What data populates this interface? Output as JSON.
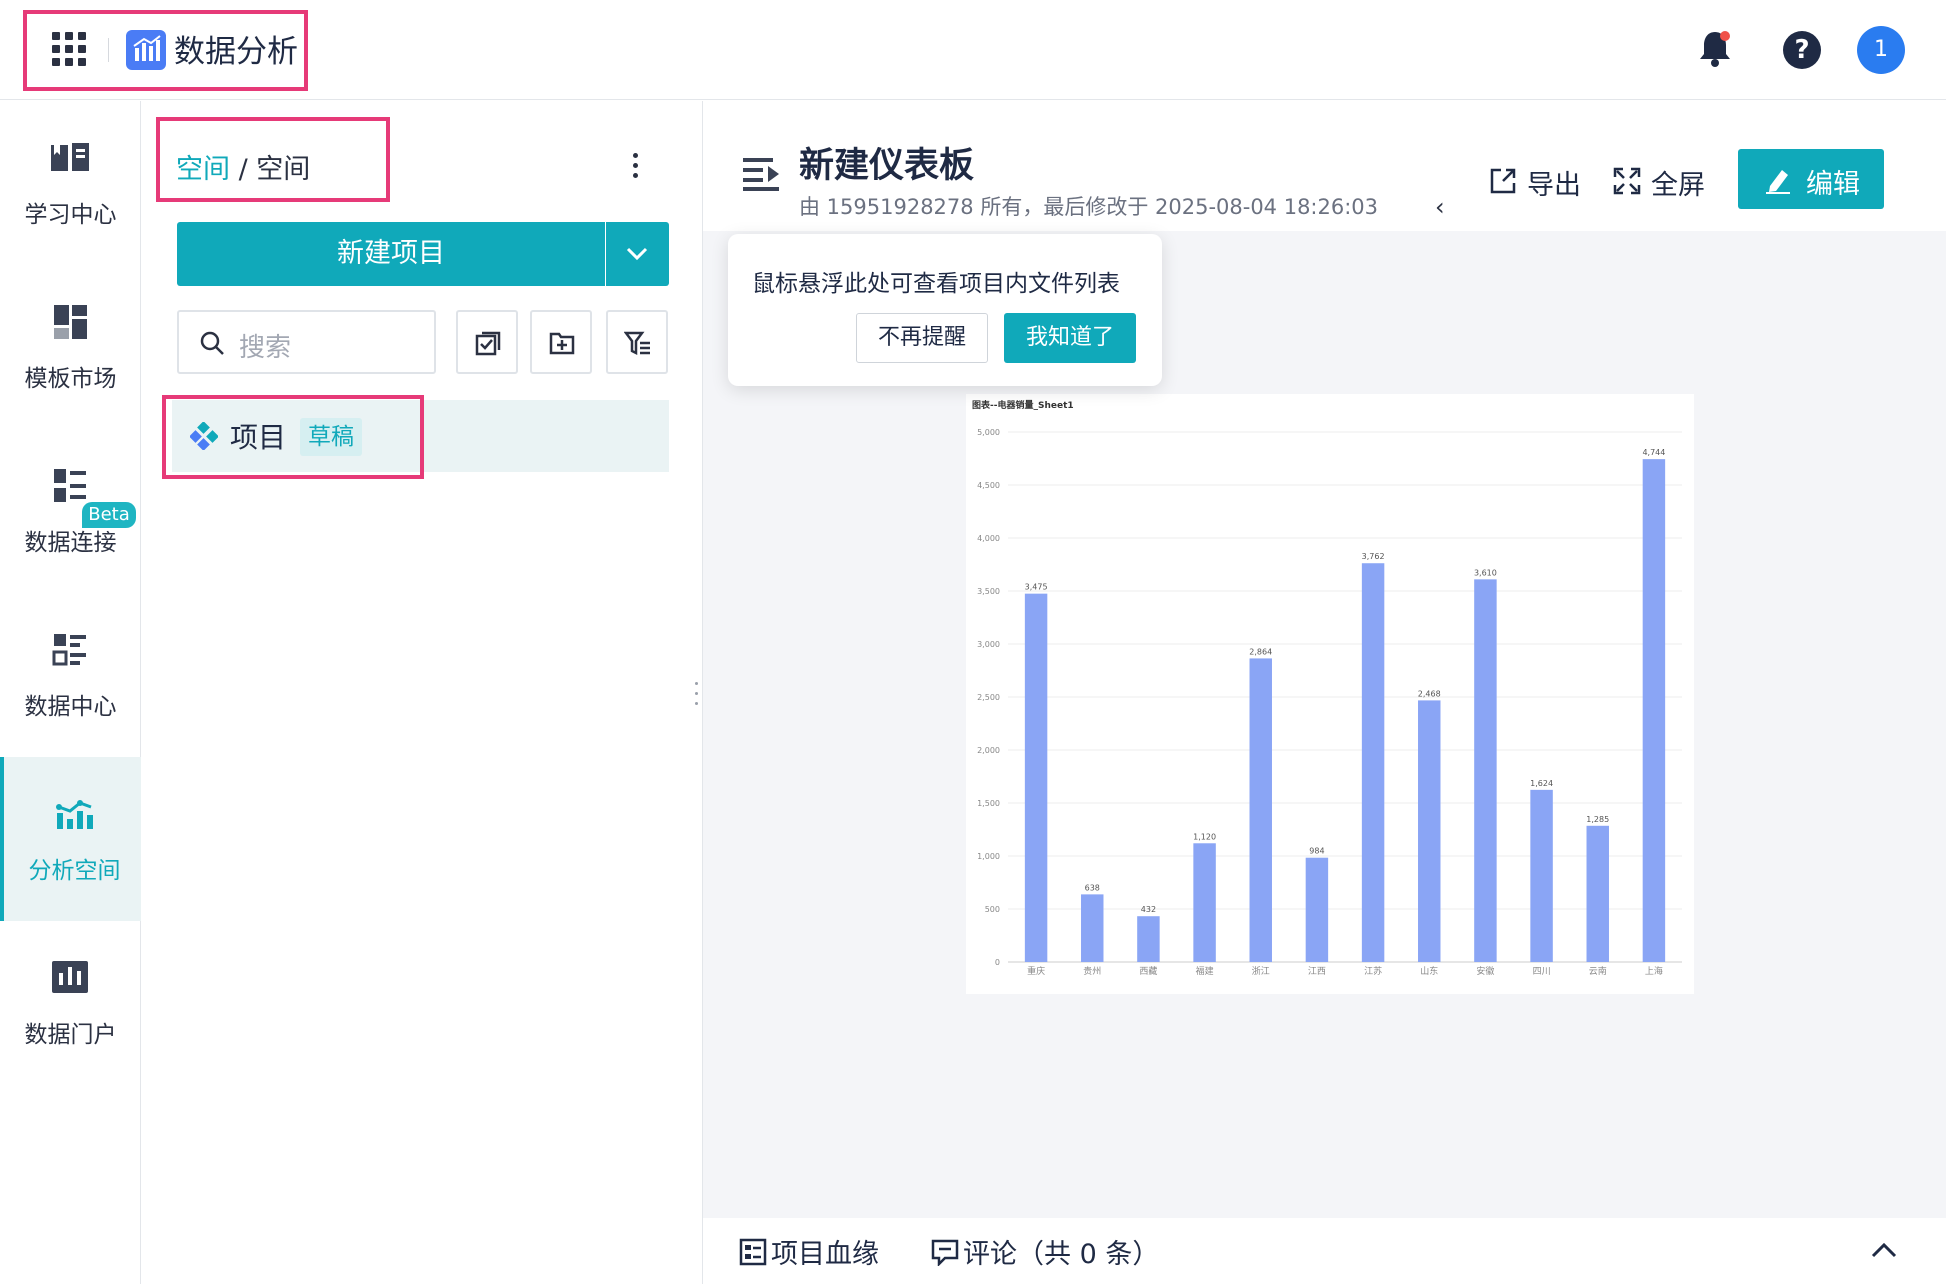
{
  "app": {
    "title": "数据分析",
    "avatar_text": "1"
  },
  "icons": {
    "apps": "grid-apps-icon",
    "bell": "bell-icon",
    "help": "help-icon"
  },
  "nav": [
    {
      "label": "学习中心",
      "icon": "book-icon"
    },
    {
      "label": "模板市场",
      "icon": "template-icon"
    },
    {
      "label": "数据连接",
      "icon": "connection-icon"
    },
    {
      "label": "数据中心",
      "icon": "data-center-icon",
      "badge": "Beta"
    },
    {
      "label": "分析空间",
      "icon": "analysis-space-icon",
      "active": true
    },
    {
      "label": "数据门户",
      "icon": "portal-icon"
    }
  ],
  "panel": {
    "breadcrumb_root": "空间",
    "breadcrumb_sep": " / ",
    "breadcrumb_current": "空间",
    "new_project": "新建项目",
    "search_placeholder": "搜索",
    "project": {
      "name": "项目",
      "tag": "草稿"
    }
  },
  "dashboard": {
    "title": "新建仪表板",
    "meta": "由 15951928278 所有，最后修改于 2025-08-04 18:26:03",
    "collapse": "‹",
    "export": "导出",
    "fullscreen": "全屏",
    "edit": "编辑"
  },
  "popover": {
    "text": "鼠标悬浮此处可查看项目内文件列表",
    "dismiss": "不再提醒",
    "ok": "我知道了"
  },
  "bottom": {
    "lineage": "项目血缘",
    "comments": "评论（共 0 条）"
  },
  "colors": {
    "accent": "#10a9ba",
    "bar": "#8aa5f5",
    "highlight": "#e63a78"
  },
  "chart_data": {
    "type": "bar",
    "title": "图表--电器销量_Sheet1",
    "categories": [
      "重庆",
      "贵州",
      "西藏",
      "福建",
      "浙江",
      "江西",
      "江苏",
      "山东",
      "安徽",
      "四川",
      "云南",
      "上海"
    ],
    "values": [
      3475,
      638,
      432,
      1120,
      2864,
      984,
      3762,
      2468,
      3610,
      1624,
      1285,
      4744
    ],
    "data_labels": [
      "3,475",
      "638",
      "432",
      "1,120",
      "2,864",
      "984",
      "3,762",
      "2,468",
      "3,610",
      "1,624",
      "1,285",
      "4,744"
    ],
    "y_ticks": [
      "0",
      "500",
      "1,000",
      "1,500",
      "2,000",
      "2,500",
      "3,000",
      "3,500",
      "4,000",
      "4,500",
      "5,000"
    ],
    "ylim": [
      0,
      5000
    ],
    "grid": true
  }
}
